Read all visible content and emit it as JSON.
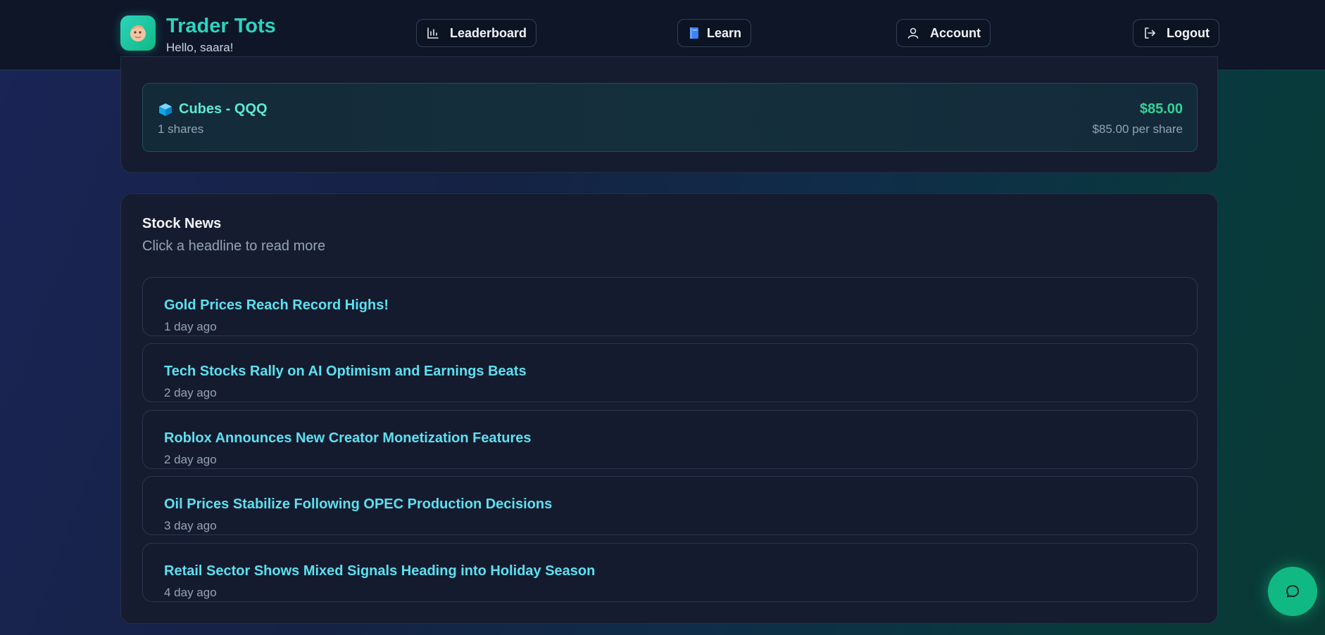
{
  "header": {
    "brand_title": "Trader Tots",
    "greeting": "Hello, saara!",
    "nav": [
      {
        "label": "Leaderboard",
        "icon": "bar-chart-icon"
      },
      {
        "label": "Learn",
        "icon": "book-icon"
      },
      {
        "label": "Account",
        "icon": "user-icon"
      },
      {
        "label": "Logout",
        "icon": "logout-icon"
      }
    ]
  },
  "portfolio": {
    "holding": {
      "name": "Cubes - QQQ",
      "shares": "1 shares",
      "value": "$85.00",
      "per_share": "$85.00 per share"
    }
  },
  "news": {
    "title": "Stock News",
    "subtitle": "Click a headline to read more",
    "items": [
      {
        "headline": "Gold Prices Reach Record Highs!",
        "time": "1 day ago"
      },
      {
        "headline": "Tech Stocks Rally on AI Optimism and Earnings Beats",
        "time": "2 day ago"
      },
      {
        "headline": "Roblox Announces New Creator Monetization Features",
        "time": "2 day ago"
      },
      {
        "headline": "Oil Prices Stabilize Following OPEC Production Decisions",
        "time": "3 day ago"
      },
      {
        "headline": "Retail Sector Shows Mixed Signals Heading into Holiday Season",
        "time": "4 day ago"
      }
    ]
  },
  "colors": {
    "accent": "#2dd4bf",
    "value_green": "#34d399",
    "headline_cyan": "#5ee0f0",
    "chat_button": "#10b981"
  }
}
